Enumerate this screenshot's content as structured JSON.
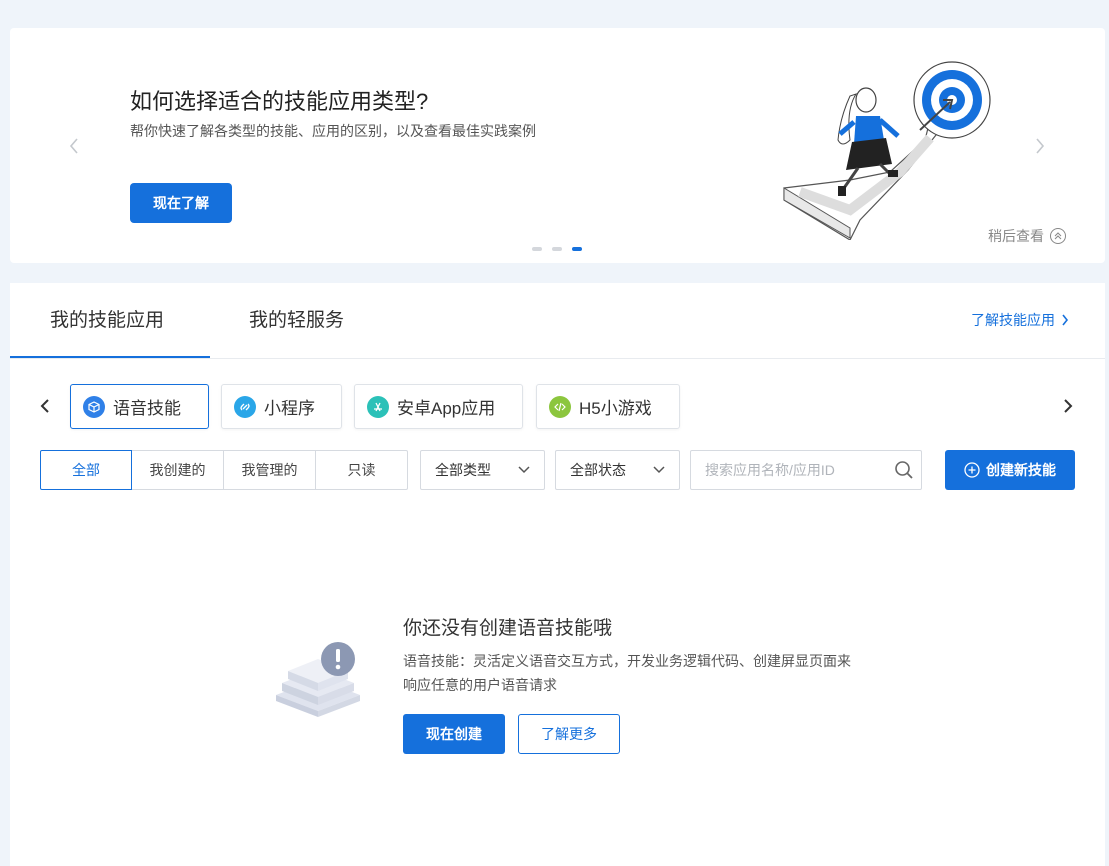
{
  "banner": {
    "title": "如何选择适合的技能应用类型?",
    "subtitle": "帮你快速了解各类型的技能、应用的区别，以及查看最佳实践案例",
    "cta_label": "现在了解",
    "later_label": "稍后查看",
    "active_slide": 3,
    "slide_count": 3
  },
  "tabs": [
    {
      "label": "我的技能应用",
      "active": true
    },
    {
      "label": "我的轻服务",
      "active": false
    }
  ],
  "learn_link": "了解技能应用",
  "categories": [
    {
      "label": "语音技能",
      "icon": "cube-icon",
      "color": "#2f80e8",
      "active": true
    },
    {
      "label": "小程序",
      "icon": "link-icon",
      "color": "#2aa6e8",
      "active": false
    },
    {
      "label": "安卓App应用",
      "icon": "app-store-icon",
      "color": "#2bc1b8",
      "active": false
    },
    {
      "label": "H5小游戏",
      "icon": "code-icon",
      "color": "#8cc63e",
      "active": false
    }
  ],
  "filters": {
    "segments": [
      {
        "label": "全部",
        "active": true
      },
      {
        "label": "我创建的",
        "active": false
      },
      {
        "label": "我管理的",
        "active": false
      },
      {
        "label": "只读",
        "active": false
      }
    ],
    "type_select": "全部类型",
    "status_select": "全部状态",
    "search_placeholder": "搜索应用名称/应用ID",
    "search_value": "",
    "create_label": "创建新技能"
  },
  "empty_state": {
    "title": "你还没有创建语音技能哦",
    "description": "语音技能：灵活定义语音交互方式，开发业务逻辑代码、创建屏显页面来响应任意的用户语音请求",
    "primary_label": "现在创建",
    "secondary_label": "了解更多"
  },
  "colors": {
    "accent": "#1570dc",
    "page_bg": "#eff4fa"
  }
}
